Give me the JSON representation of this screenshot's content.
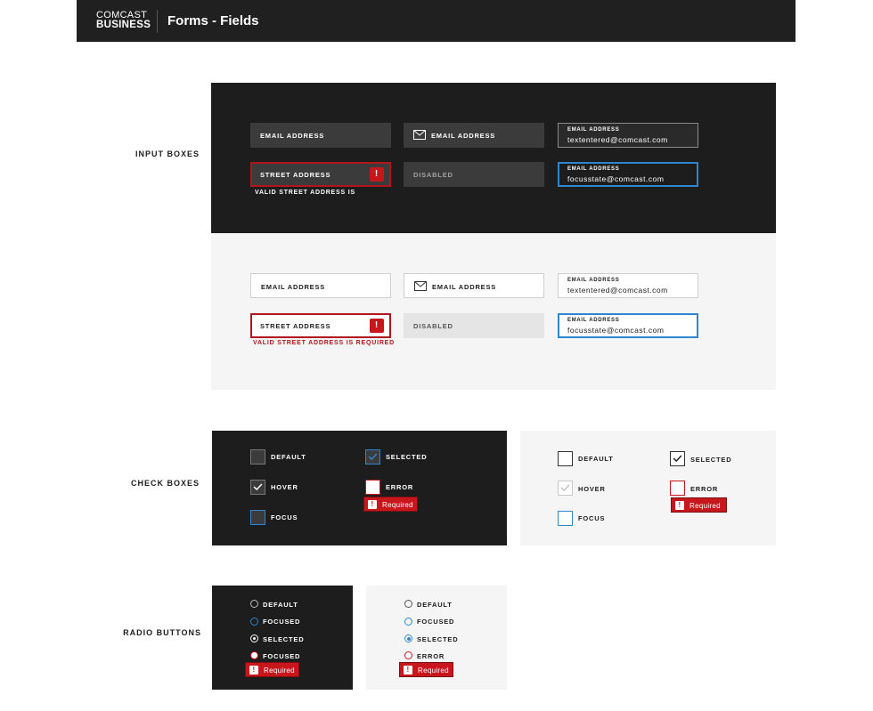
{
  "header": {
    "logo_line1": "COMCAST",
    "logo_line2": "BUSINESS",
    "title": "Forms - Fields"
  },
  "sections": {
    "input_boxes": "INPUT BOXES",
    "check_boxes": "CHECK BOXES",
    "radio_buttons": "RADIO BUTTONS"
  },
  "inputs_dark": {
    "default": "EMAIL ADDRESS",
    "icon": "EMAIL ADDRESS",
    "filled_label": "EMAIL ADDRESS",
    "filled_value": "textentered@comcast.com",
    "error": "STREET ADDRESS",
    "error_message": "VALID STREET ADDRESS IS",
    "disabled": "DISABLED",
    "focus_label": "EMAIL ADDRESS",
    "focus_value": "focusstate@comcast.com"
  },
  "inputs_light": {
    "default": "EMAIL ADDRESS",
    "icon": "EMAIL ADDRESS",
    "filled_label": "EMAIL ADDRESS",
    "filled_value": "textentered@comcast.com",
    "error": "STREET ADDRESS",
    "error_message": "VALID STREET ADDRESS IS REQUIRED",
    "disabled": "DISABLED",
    "focus_label": "EMAIL ADDRESS",
    "focus_value": "focusstate@comcast.com"
  },
  "checkboxes_dark": {
    "default": "DEFAULT",
    "hover": "HOVER",
    "focus": "FOCUS",
    "selected": "SELECTED",
    "error": "ERROR",
    "required": "Required"
  },
  "checkboxes_light": {
    "default": "DEFAULT",
    "hover": "HOVER",
    "focus": "FOCUS",
    "selected": "SELECTED",
    "error": "ERROR",
    "required": "Required"
  },
  "radios_dark": {
    "default": "DEFAULT",
    "focused": "FOCUSED",
    "selected": "SELECTED",
    "error": "FOCUSED",
    "required": "Required"
  },
  "radios_light": {
    "default": "DEFAULT",
    "focused": "FOCUSED",
    "selected": "SELECTED",
    "error": "ERROR",
    "required": "Required"
  },
  "error_glyph": "!",
  "colors": {
    "dark_bg": "#1d1d1d",
    "light_bg": "#f5f5f5",
    "error_red": "#c8161d",
    "focus_blue": "#2e86d1"
  }
}
